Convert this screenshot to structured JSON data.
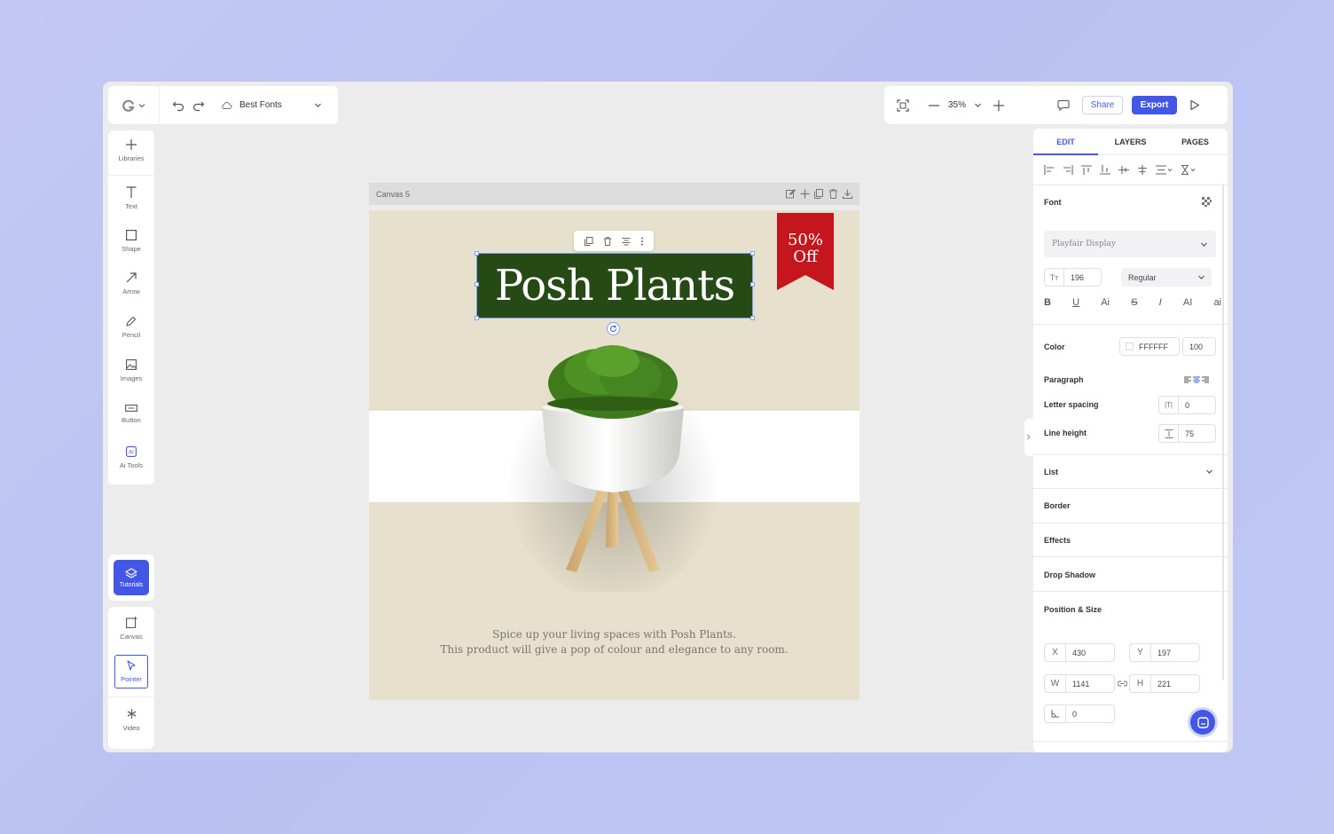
{
  "toolbar": {
    "document_name": "Best Fonts",
    "zoom": "35%",
    "share_label": "Share",
    "export_label": "Export"
  },
  "left_tools": [
    {
      "label": "Libraries",
      "icon": "plus-icon"
    },
    {
      "label": "Text",
      "icon": "text-icon"
    },
    {
      "label": "Shape",
      "icon": "square-icon"
    },
    {
      "label": "Arrow",
      "icon": "arrow-icon"
    },
    {
      "label": "Pencil",
      "icon": "pencil-icon"
    },
    {
      "label": "Images",
      "icon": "image-icon"
    },
    {
      "label": "Button",
      "icon": "button-icon"
    },
    {
      "label": "Ai Tools",
      "icon": "ai-icon"
    }
  ],
  "tutorials": {
    "label": "Tutorials"
  },
  "bottom_tools": [
    {
      "label": "Canvas",
      "icon": "canvas-icon"
    },
    {
      "label": "Pointer",
      "icon": "pointer-icon"
    },
    {
      "label": "Video",
      "icon": "video-icon"
    }
  ],
  "canvas": {
    "title": "Canvas 5",
    "headline": "Posh Plants",
    "ribbon_line1": "50%",
    "ribbon_line2": "Off",
    "tagline_line1": "Spice up your living spaces with Posh Plants.",
    "tagline_line2": "This product will give a pop of colour and elegance to any room.",
    "colors": {
      "background": "#e6e0cc",
      "headline_bg": "#264a15",
      "ribbon": "#c4161c"
    }
  },
  "panel": {
    "tabs": [
      "EDIT",
      "LAYERS",
      "PAGES"
    ],
    "active_tab": "EDIT",
    "font_label": "Font",
    "font_family": "Playfair Display",
    "font_size": "196",
    "font_weight": "Regular",
    "style_buttons": [
      "B",
      "U",
      "Ai",
      "S",
      "I",
      "AI",
      "ai"
    ],
    "color_label": "Color",
    "color_hex": "FFFFFF",
    "color_opacity": "100",
    "paragraph_label": "Paragraph",
    "letter_spacing_label": "Letter spacing",
    "letter_spacing": "0",
    "line_height_label": "Line height",
    "line_height": "75",
    "list_label": "List",
    "border_label": "Border",
    "effects_label": "Effects",
    "drop_shadow_label": "Drop Shadow",
    "position_size_label": "Position & Size",
    "x_label": "X",
    "x": "430",
    "y_label": "Y",
    "y": "197",
    "w_label": "W",
    "w": "1141",
    "h_label": "H",
    "h": "221",
    "angle": "0"
  }
}
